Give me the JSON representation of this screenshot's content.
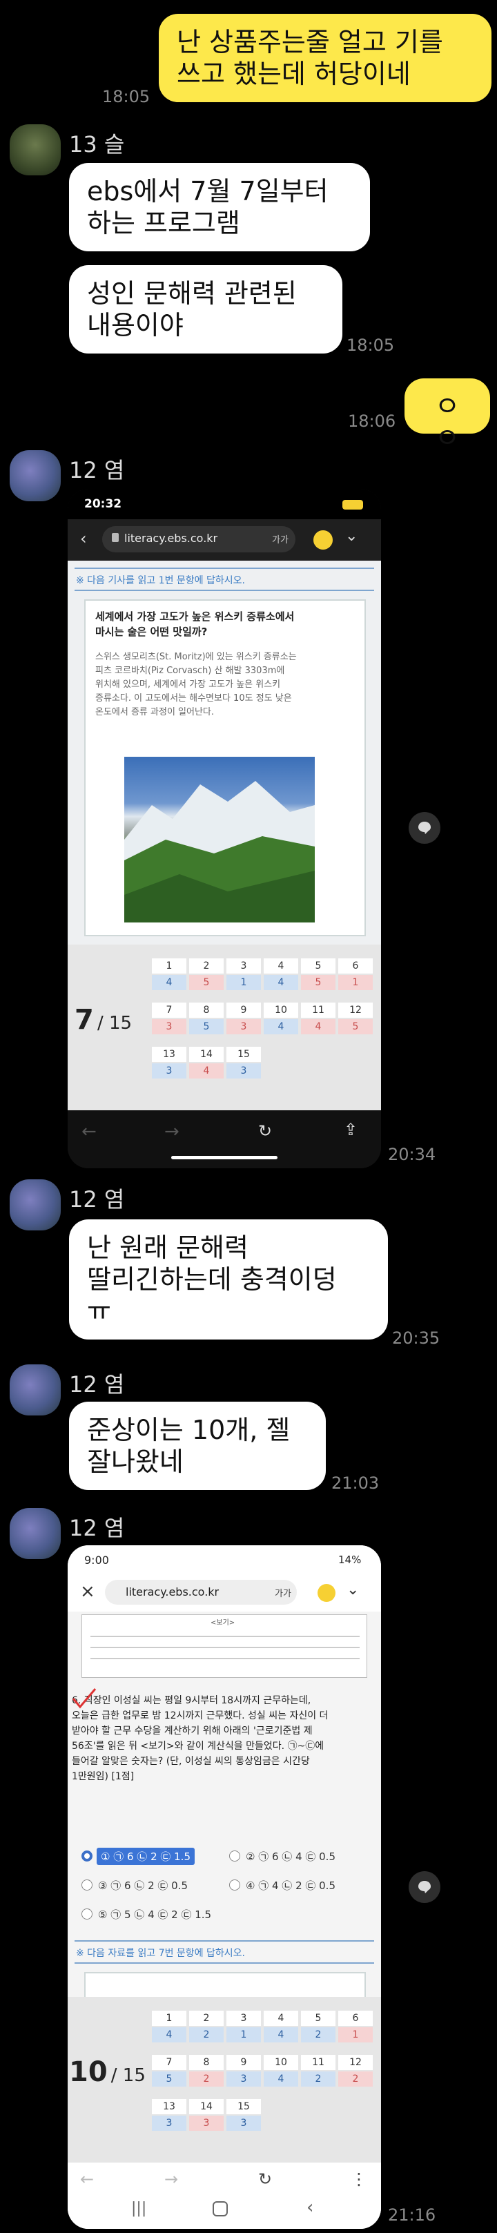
{
  "messages": {
    "m1": {
      "text": "난 상품주는줄 얼고 기를\n쓰고 했는데 허당이네",
      "time": "18:05"
    },
    "m2_sender": "13 슬",
    "m2a": "ebs에서 7월 7일부터\n하는 프로그램",
    "m2b": "성인 문해력 관련된\n내용이야",
    "m2_time": "18:05",
    "m3": {
      "text": "ㅇㅇ",
      "time": "18:06"
    },
    "m4_sender": "12 염",
    "m4_time": "20:34",
    "m5_sender": "12 염",
    "m5": "난 원래 문해력\n딸리긴하는데 충격이덩\nㅠ",
    "m5_time": "20:35",
    "m6_sender": "12 염",
    "m6": "준상이는 10개, 젤\n잘나왔네",
    "m6_time": "21:03",
    "m7_sender": "12 염",
    "m7_time": "21:16"
  },
  "shot1": {
    "status_time": "20:32",
    "url": "literacy.ebs.co.kr",
    "font_btn": "가가",
    "instruction": "※ 다음 기사를 읽고 1번 문항에 답하시오.",
    "article_title": "세계에서 가장 고도가 높은 위스키 증류소에서\n마시는 술은 어떤 맛일까?",
    "article_body": "스위스 생모리츠(St. Moritz)에 있는 위스키 증류소는\n피츠 코르바치(Piz Corvasch) 산 해발 3303m에\n위치해 있으며, 세계에서 가장 고도가 높은 위스키\n증류소다. 이 고도에서는 해수면보다 10도 정도 낮은\n온도에서 증류 과정이 일어난다.",
    "progress_current": "7",
    "progress_total": "/ 15",
    "grid_numbers": [
      "1",
      "2",
      "3",
      "4",
      "5",
      "6",
      "7",
      "8",
      "9",
      "10",
      "11",
      "12",
      "13",
      "14",
      "15"
    ],
    "grid_answers": [
      "4",
      "5",
      "1",
      "4",
      "5",
      "1",
      "3",
      "5",
      "3",
      "4",
      "4",
      "5",
      "3",
      "4",
      "3"
    ],
    "answer_colors": [
      "blue",
      "red",
      "blue",
      "blue",
      "red",
      "red",
      "red",
      "blue",
      "red",
      "blue",
      "red",
      "red",
      "blue",
      "red",
      "blue"
    ]
  },
  "shot2": {
    "status_time": "9:00",
    "battery": "14%",
    "url": "literacy.ebs.co.kr",
    "font_btn": "가가",
    "box_label": "<보기>",
    "question": "6. 직장인 이성실 씨는 평일 9시부터 18시까지 근무하는데,\n오늘은 급한 업무로 밤 12시까지 근무했다. 성실 씨는 자신이 더\n받아야 할 근무 수당을 계산하기 위해 아래의 '근로기준법 제\n56조'를 읽은 뒤 <보기>와 같이 계산식을 만들었다. ㉠~㉢에\n들어갈 알맞은 숫자는? (단, 이성실 씨의 통상임금은 시간당\n1만원임) [1점]",
    "options": [
      "① ㉠ 6 ㉡ 2 ㉢ 1.5",
      "② ㉠ 6 ㉡ 4 ㉢ 0.5",
      "③ ㉠ 6 ㉡ 2 ㉢ 0.5",
      "④ ㉠ 4 ㉡ 2 ㉢ 0.5",
      "⑤ ㉠ 5 ㉡ 4 ㉢ 2 ㉢ 1.5"
    ],
    "instruction2": "※ 다음 자료를 읽고 7번 문항에 답하시오.",
    "progress_current": "10",
    "progress_total": "/ 15",
    "grid_numbers": [
      "1",
      "2",
      "3",
      "4",
      "5",
      "6",
      "7",
      "8",
      "9",
      "10",
      "11",
      "12",
      "13",
      "14",
      "15"
    ],
    "grid_answers": [
      "4",
      "2",
      "1",
      "4",
      "2",
      "1",
      "5",
      "2",
      "3",
      "4",
      "2",
      "2",
      "3",
      "3",
      "3"
    ],
    "answer_colors": [
      "blue",
      "blue",
      "blue",
      "blue",
      "blue",
      "red",
      "blue",
      "red",
      "blue",
      "blue",
      "blue",
      "red",
      "blue",
      "red",
      "blue"
    ]
  }
}
